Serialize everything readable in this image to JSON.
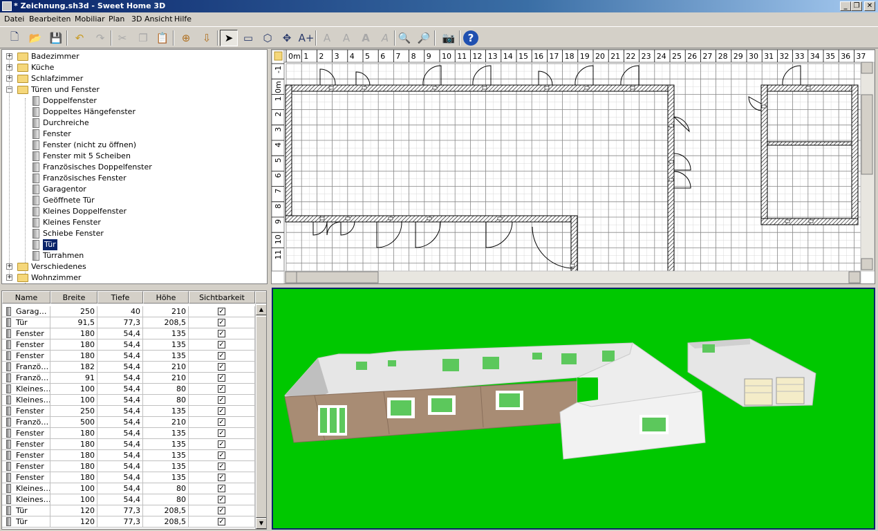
{
  "window": {
    "title": "* Zeichnung.sh3d - Sweet Home 3D"
  },
  "menu": [
    "Datei",
    "Bearbeiten",
    "Mobiliar",
    "Plan",
    "3D Ansicht",
    "Hilfe"
  ],
  "tree": {
    "categories": [
      {
        "label": "Badezimmer",
        "expanded": false
      },
      {
        "label": "Küche",
        "expanded": false
      },
      {
        "label": "Schlafzimmer",
        "expanded": false
      },
      {
        "label": "Türen und Fenster",
        "expanded": true,
        "items": [
          "Doppelfenster",
          "Doppeltes Hängefenster",
          "Durchreiche",
          "Fenster",
          "Fenster (nicht zu öffnen)",
          "Fenster mit 5 Scheiben",
          "Französisches Doppelfenster",
          "Französisches Fenster",
          "Garagentor",
          "Geöffnete Tür",
          "Kleines Doppelfenster",
          "Kleines Fenster",
          "Schiebe Fenster",
          "Tür",
          "Türrahmen"
        ],
        "selected": "Tür"
      },
      {
        "label": "Verschiedenes",
        "expanded": false
      },
      {
        "label": "Wohnzimmer",
        "expanded": false
      }
    ]
  },
  "table": {
    "columns": [
      "Name",
      "Breite",
      "Tiefe",
      "Höhe",
      "Sichtbarkeit"
    ],
    "rows": [
      [
        "Garag…",
        "250",
        "40",
        "210",
        "✓"
      ],
      [
        "Tür",
        "91,5",
        "77,3",
        "208,5",
        "✓"
      ],
      [
        "Fenster",
        "180",
        "54,4",
        "135",
        "✓"
      ],
      [
        "Fenster",
        "180",
        "54,4",
        "135",
        "✓"
      ],
      [
        "Fenster",
        "180",
        "54,4",
        "135",
        "✓"
      ],
      [
        "Franzö…",
        "182",
        "54,4",
        "210",
        "✓"
      ],
      [
        "Franzö…",
        "91",
        "54,4",
        "210",
        "✓"
      ],
      [
        "Kleines…",
        "100",
        "54,4",
        "80",
        "✓"
      ],
      [
        "Kleines…",
        "100",
        "54,4",
        "80",
        "✓"
      ],
      [
        "Fenster",
        "250",
        "54,4",
        "135",
        "✓"
      ],
      [
        "Franzö…",
        "500",
        "54,4",
        "210",
        "✓"
      ],
      [
        "Fenster",
        "180",
        "54,4",
        "135",
        "✓"
      ],
      [
        "Fenster",
        "180",
        "54,4",
        "135",
        "✓"
      ],
      [
        "Fenster",
        "180",
        "54,4",
        "135",
        "✓"
      ],
      [
        "Fenster",
        "180",
        "54,4",
        "135",
        "✓"
      ],
      [
        "Fenster",
        "180",
        "54,4",
        "135",
        "✓"
      ],
      [
        "Kleines…",
        "100",
        "54,4",
        "80",
        "✓"
      ],
      [
        "Kleines…",
        "100",
        "54,4",
        "80",
        "✓"
      ],
      [
        "Tür",
        "120",
        "77,3",
        "208,5",
        "✓"
      ],
      [
        "Tür",
        "120",
        "77,3",
        "208,5",
        "✓"
      ]
    ]
  },
  "plan": {
    "ruler_x": [
      "0m",
      "1",
      "2",
      "3",
      "4",
      "5",
      "6",
      "7",
      "8",
      "9",
      "10",
      "11",
      "12",
      "13",
      "14",
      "15",
      "16",
      "17",
      "18",
      "19",
      "20",
      "21",
      "22",
      "23",
      "24",
      "25",
      "26",
      "27",
      "28",
      "29",
      "30",
      "31",
      "32",
      "33",
      "34",
      "35",
      "36",
      "37"
    ],
    "ruler_y": [
      "-1",
      "0m",
      "1",
      "2",
      "3",
      "4",
      "5",
      "6",
      "7",
      "8",
      "9",
      "10",
      "11"
    ]
  },
  "view3d": {
    "ground_color": "#00c800"
  },
  "colors": {
    "selection": "#0a246a",
    "folder": "#f5d77a"
  }
}
